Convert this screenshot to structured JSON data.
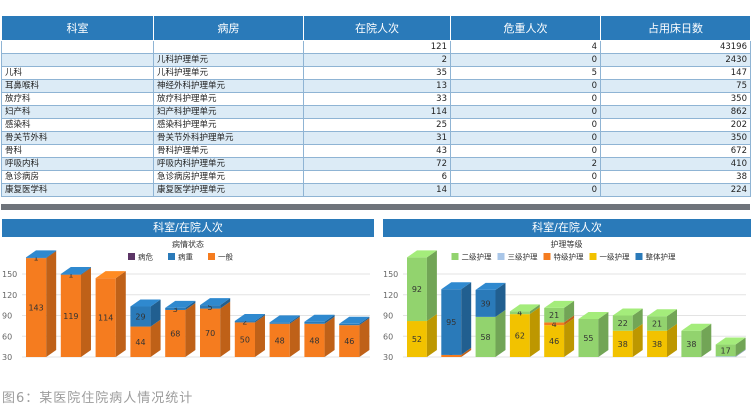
{
  "table": {
    "headers": [
      "科室",
      "病房",
      "在院人次",
      "危重人次",
      "占用床日数"
    ],
    "rows": [
      [
        "",
        "",
        "121",
        "4",
        "43196"
      ],
      [
        "",
        "儿科护理单元",
        "2",
        "0",
        "2430"
      ],
      [
        "儿科",
        "儿科护理单元",
        "35",
        "5",
        "147"
      ],
      [
        "耳鼻喉科",
        "神经外科护理单元",
        "13",
        "0",
        "75"
      ],
      [
        "放疗科",
        "放疗科护理单元",
        "33",
        "0",
        "350"
      ],
      [
        "妇产科",
        "妇产科护理单元",
        "114",
        "0",
        "862"
      ],
      [
        "感染科",
        "感染科护理单元",
        "25",
        "0",
        "202"
      ],
      [
        "骨关节外科",
        "骨关节外科护理单元",
        "31",
        "0",
        "350"
      ],
      [
        "骨科",
        "骨科护理单元",
        "43",
        "0",
        "672"
      ],
      [
        "呼吸内科",
        "呼吸内科护理单元",
        "72",
        "2",
        "410"
      ],
      [
        "急诊病房",
        "急诊病房护理单元",
        "6",
        "0",
        "38"
      ],
      [
        "康复医学科",
        "康复医学护理单元",
        "14",
        "0",
        "224"
      ]
    ]
  },
  "caption": "图6：某医院住院病人情况统计",
  "chart_data": [
    {
      "type": "bar",
      "stacked": true,
      "title": "科室/在院人次",
      "legend_title": "病情状态",
      "legend_position": "top",
      "y_ticks": [
        30,
        60,
        90,
        120,
        150
      ],
      "ylim": [
        30,
        150
      ],
      "grid": true,
      "series": [
        {
          "name": "病危",
          "color": "#5c3566",
          "values": [
            0,
            0,
            0,
            0,
            0,
            0,
            0,
            0,
            0,
            0
          ]
        },
        {
          "name": "病重",
          "color": "#2a7ab9",
          "values": [
            1,
            1,
            0,
            29,
            3,
            5,
            2,
            2,
            3,
            2
          ]
        },
        {
          "name": "一般",
          "color": "#f57c1f",
          "values": [
            143,
            119,
            114,
            44,
            68,
            70,
            50,
            48,
            48,
            46
          ]
        }
      ],
      "labels": [
        [
          "",
          "",
          ""
        ],
        [
          "",
          "",
          ""
        ],
        [
          "",
          "",
          ""
        ],
        [
          "",
          "29",
          "44"
        ],
        [
          "",
          "3",
          "68"
        ],
        [
          "",
          "5",
          "70"
        ],
        [
          "",
          "2",
          "50"
        ],
        [
          "",
          "",
          "48"
        ],
        [
          "",
          "",
          "48"
        ],
        [
          "",
          "",
          "46"
        ]
      ],
      "labels_full": [
        [
          "",
          "1",
          "143"
        ],
        [
          "",
          "1",
          "119"
        ],
        [
          "",
          "",
          "114"
        ],
        [
          "",
          "29",
          "44"
        ],
        [
          "",
          "3",
          "68"
        ],
        [
          "",
          "5",
          "70"
        ],
        [
          "",
          "2",
          "50"
        ],
        [
          "",
          "",
          "48"
        ],
        [
          "",
          "",
          "48"
        ],
        [
          "",
          "",
          "46"
        ]
      ]
    },
    {
      "type": "bar",
      "stacked": true,
      "title": "科室/在院人次",
      "legend_title": "护理等级",
      "legend_position": "top",
      "y_ticks": [
        30,
        60,
        90,
        120,
        150
      ],
      "ylim": [
        30,
        150
      ],
      "grid": true,
      "series": [
        {
          "name": "二级护理",
          "color": "#92d36e",
          "values": [
            92,
            0,
            58,
            4,
            21,
            55,
            22,
            21,
            38,
            17
          ]
        },
        {
          "name": "三级护理",
          "color": "#a9c6e8",
          "values": [
            0,
            0,
            0,
            0,
            0,
            0,
            0,
            0,
            0,
            1
          ]
        },
        {
          "name": "特级护理",
          "color": "#f57c1f",
          "values": [
            0,
            3,
            0,
            0,
            4,
            0,
            0,
            0,
            0,
            0
          ]
        },
        {
          "name": "一级护理",
          "color": "#f2c200",
          "values": [
            52,
            0,
            0,
            62,
            46,
            0,
            38,
            38,
            0,
            0
          ]
        },
        {
          "name": "整体护理",
          "color": "#2a7ab9",
          "values": [
            0,
            95,
            39,
            0,
            0,
            0,
            0,
            0,
            0,
            0
          ]
        }
      ],
      "labels_full": [
        [
          "92",
          "",
          "",
          "52",
          ""
        ],
        [
          "",
          "",
          "3",
          "",
          "95"
        ],
        [
          "58",
          "",
          "",
          "",
          "39"
        ],
        [
          "4",
          "",
          "",
          "62",
          ""
        ],
        [
          "21",
          "",
          "4",
          "46",
          ""
        ],
        [
          "55",
          "",
          "",
          "",
          ""
        ],
        [
          "22",
          "",
          "",
          "38",
          ""
        ],
        [
          "21",
          "",
          "",
          "38",
          ""
        ],
        [
          "38",
          "",
          "",
          "",
          ""
        ],
        [
          "17",
          "",
          "",
          "",
          ""
        ]
      ]
    }
  ]
}
